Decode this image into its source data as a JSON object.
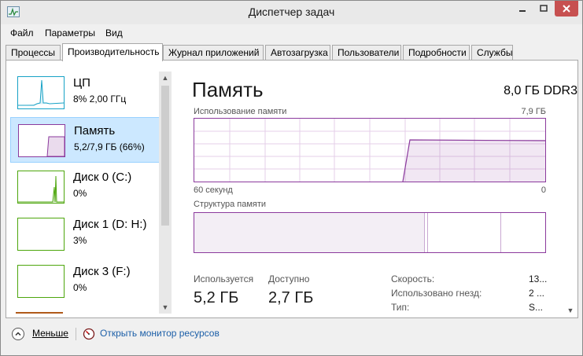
{
  "window": {
    "title": "Диспетчер задач"
  },
  "menu": [
    "Файл",
    "Параметры",
    "Вид"
  ],
  "tabs": [
    {
      "label": "Процессы",
      "active": false
    },
    {
      "label": "Производительность",
      "active": true
    },
    {
      "label": "Журнал приложений",
      "active": false
    },
    {
      "label": "Автозагрузка",
      "active": false
    },
    {
      "label": "Пользователи",
      "active": false
    },
    {
      "label": "Подробности",
      "active": false
    },
    {
      "label": "Службы",
      "active": false
    }
  ],
  "sidebar": {
    "items": [
      {
        "name": "ЦП",
        "sub": "8% 2,00 ГГц",
        "color": "#17a2c6",
        "selected": false
      },
      {
        "name": "Память",
        "sub": "5,2/7,9 ГБ (66%)",
        "color": "#8b3a9d",
        "selected": true
      },
      {
        "name": "Диск 0 (C:)",
        "sub": "0%",
        "color": "#4da60c",
        "selected": false
      },
      {
        "name": "Диск 1 (D: H:)",
        "sub": "3%",
        "color": "#4da60c",
        "selected": false
      },
      {
        "name": "Диск 3 (F:)",
        "sub": "0%",
        "color": "#4da60c",
        "selected": false
      }
    ]
  },
  "main": {
    "title": "Память",
    "subtitle": "8,0 ГБ DDR3",
    "usage_label": "Использование памяти",
    "usage_max": "7,9 ГБ",
    "axis_left": "60 секунд",
    "axis_right": "0",
    "structure_label": "Структура памяти",
    "used_label": "Используется",
    "used_value": "5,2 ГБ",
    "available_label": "Доступно",
    "available_value": "2,7 ГБ",
    "details": [
      {
        "label": "Скорость:",
        "value": "13..."
      },
      {
        "label": "Использовано гнезд:",
        "value": "2 ..."
      },
      {
        "label": "Тип:",
        "value": "S..."
      }
    ]
  },
  "footer": {
    "fewer": "Меньше",
    "resource_monitor": "Открыть монитор ресурсов"
  },
  "colors": {
    "memory": "#8b3a9d",
    "cpu": "#17a2c6",
    "disk": "#4da60c",
    "selection": "#cce8ff",
    "link": "#1c5fa8",
    "close": "#c75050"
  }
}
